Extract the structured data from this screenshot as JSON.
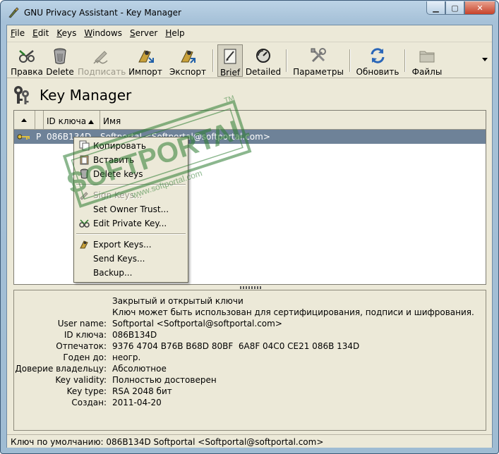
{
  "window": {
    "title": "GNU Privacy Assistant - Key Manager"
  },
  "menu": [
    {
      "label": "File",
      "u": "F",
      "rest": "ile"
    },
    {
      "label": "Edit",
      "u": "E",
      "rest": "dit"
    },
    {
      "label": "Keys",
      "u": "K",
      "rest": "eys"
    },
    {
      "label": "Windows",
      "u": "W",
      "rest": "indows"
    },
    {
      "label": "Server",
      "u": "S",
      "rest": "erver"
    },
    {
      "label": "Help",
      "u": "H",
      "rest": "elp"
    }
  ],
  "toolbar": {
    "edit": "Правка",
    "delete": "Delete",
    "sign": "Подписать",
    "import": "Импорт",
    "export": "Экспорт",
    "brief": "Brief",
    "detailed": "Detailed",
    "params": "Параметры",
    "refresh": "Обновить",
    "files": "Файлы"
  },
  "header": {
    "title": "Key Manager"
  },
  "list": {
    "col_keyid": "ID ключа",
    "col_name": "Имя",
    "row": {
      "flag": "P",
      "keyid": "086B134D",
      "name": "Softportal <Softportal@softportal.com>"
    }
  },
  "context_menu": {
    "copy": "Копировать",
    "paste": "Вставить",
    "delete_keys": "Delete keys",
    "sign_keys": "Sign Keys...",
    "owner_trust": "Set Owner Trust...",
    "edit_private": "Edit Private Key...",
    "export_keys": "Export Keys...",
    "send_keys": "Send Keys...",
    "backup": "Backup..."
  },
  "details": {
    "kind": "Закрытый и открытый ключи",
    "usage": "Ключ может быть использован для сертифицирования, подписи и шифрования.",
    "rows": [
      {
        "k": "User name:",
        "v": "Softportal <Softportal@softportal.com>"
      },
      {
        "k": "ID ключа:",
        "v": "086B134D"
      },
      {
        "k": "Отпечаток:",
        "v": "9376 4704 B76B B68D 80BF  6A8F 04C0 CE21 086B 134D"
      },
      {
        "k": "Годен до:",
        "v": "неогр."
      },
      {
        "k": "Доверие владельцу:",
        "v": "Абсолютное"
      },
      {
        "k": "Key validity:",
        "v": "Полностью достоверен"
      },
      {
        "k": "Key type:",
        "v": "RSA 2048 бит"
      },
      {
        "k": "Создан:",
        "v": "2011-04-20"
      }
    ]
  },
  "status": {
    "text": "Ключ по умолчанию: 086B134D Softportal <Softportal@softportal.com>"
  },
  "watermark": {
    "text": "SOFTPORTAL",
    "url": "www.softportal.com",
    "tm": "TM"
  },
  "colors": {
    "selection": "#6e8298",
    "window_face": "#ece9d8",
    "accent_watermark": "#2e7d32"
  }
}
